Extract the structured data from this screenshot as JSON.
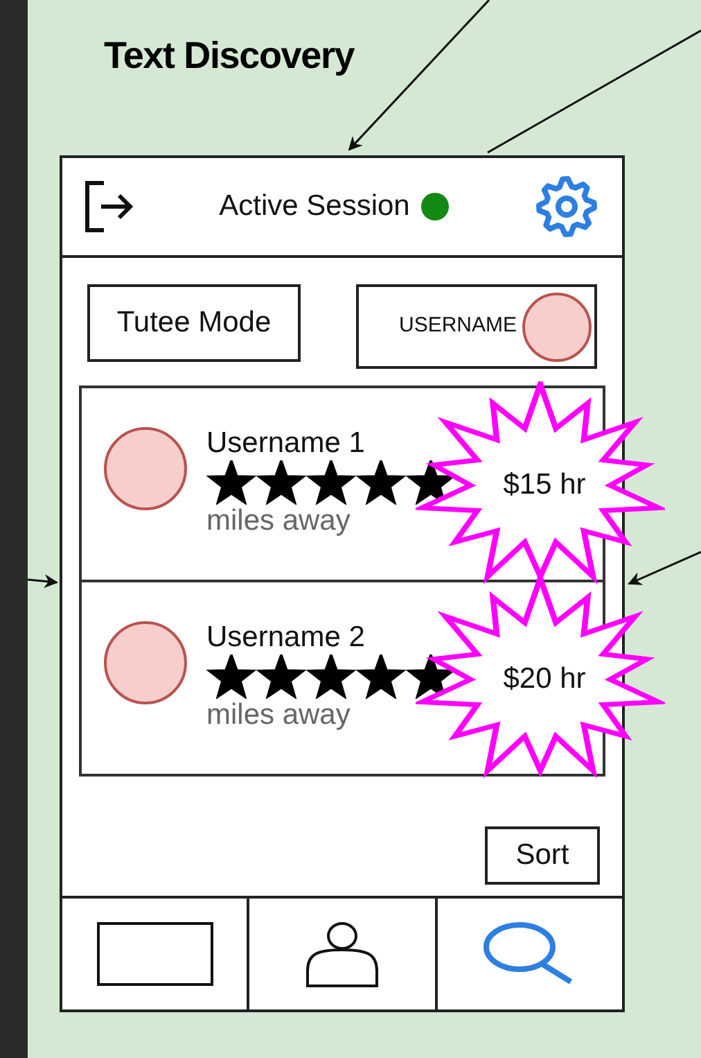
{
  "title": "Text Discovery",
  "header": {
    "session_label": "Active Session",
    "session_active": true
  },
  "mode_button": "Tutee Mode",
  "user_chip": {
    "label": "USERNAME"
  },
  "tutors": [
    {
      "name": "Username 1",
      "stars": 5,
      "distance": "miles away",
      "price": "$15 hr"
    },
    {
      "name": "Username 2",
      "stars": 5,
      "distance": "miles away",
      "price": "$20 hr"
    }
  ],
  "sort_button": "Sort",
  "nav": [
    {
      "kind": "box",
      "selected": false
    },
    {
      "kind": "person",
      "selected": false
    },
    {
      "kind": "search",
      "selected": true
    }
  ]
}
